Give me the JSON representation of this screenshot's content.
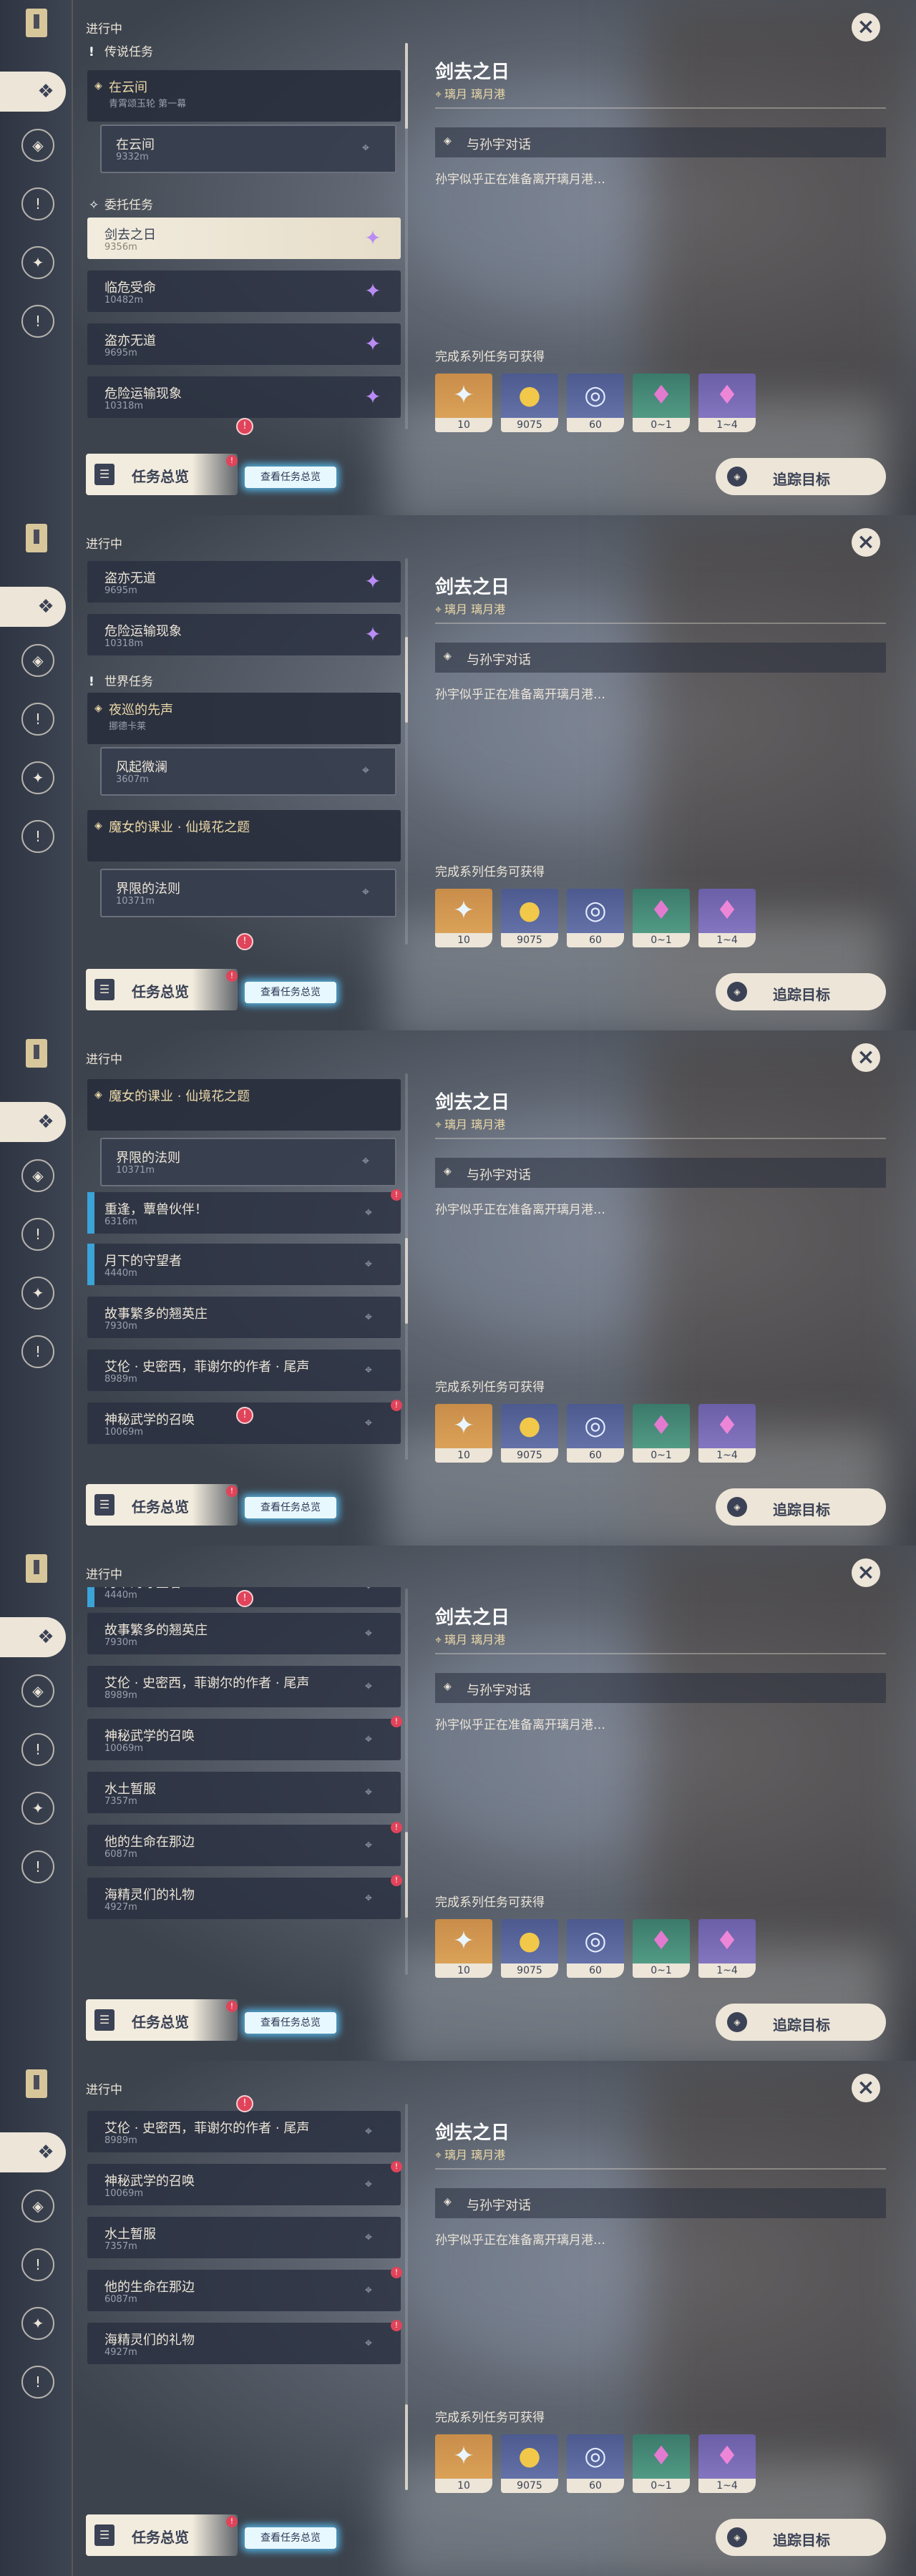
{
  "header": {
    "in_progress": "进行中"
  },
  "sections": {
    "legendary": "传说任务",
    "commission": "委托任务",
    "world": "世界任务"
  },
  "legend_chain": {
    "title": "在云间",
    "sub": "青霄颂玉轮 第一幕"
  },
  "legend_sub": {
    "name": "在云间",
    "dist": "9332m"
  },
  "commissions": [
    {
      "name": "剑去之日",
      "dist": "9356m"
    },
    {
      "name": "临危受命",
      "dist": "10482m"
    },
    {
      "name": "盗亦无道",
      "dist": "9695m"
    },
    {
      "name": "危险运输现象",
      "dist": "10318m"
    }
  ],
  "world_chain1": {
    "title": "夜巡的先声",
    "sub": "挪德卡莱"
  },
  "world_sub1": {
    "name": "风起微澜",
    "dist": "3607m"
  },
  "world_chain2": {
    "title": "魔女的课业 · 仙境花之题"
  },
  "world_sub2": {
    "name": "界限的法则",
    "dist": "10371m"
  },
  "world_items": [
    {
      "name": "重逢，蕈兽伙伴！",
      "dist": "6316m"
    },
    {
      "name": "月下的守望者",
      "dist": "4440m"
    },
    {
      "name": "故事繁多的翘英庄",
      "dist": "7930m"
    },
    {
      "name": "艾伦 · 史密西，菲谢尔的作者 · 尾声",
      "dist": "8989m"
    },
    {
      "name": "神秘武学的召唤",
      "dist": "10069m"
    },
    {
      "name": "水土暂服",
      "dist": "7357m"
    },
    {
      "name": "他的生命在那边",
      "dist": "6087m"
    },
    {
      "name": "海精灵们的礼物",
      "dist": "4927m"
    }
  ],
  "details": {
    "title": "剑去之日",
    "location": "璃月  璃月港",
    "objective": "与孙宇对话",
    "description": "孙宇似乎正在准备离开璃月港…",
    "rewards_title": "完成系列任务可获得",
    "rewards": [
      {
        "icon": "primogem-icon",
        "count": "10"
      },
      {
        "icon": "mora-icon",
        "count": "9075"
      },
      {
        "icon": "exp-icon",
        "count": "60"
      },
      {
        "icon": "ore-icon",
        "count": "0~1"
      },
      {
        "icon": "crystal-icon",
        "count": "1~4"
      }
    ]
  },
  "footer": {
    "overview": "任务总览",
    "view_all": "查看任务总览",
    "track": "追踪目标"
  },
  "colors": {
    "accent": "#ece5d8",
    "purple_star": "#b98cf5",
    "alert": "#e0445a",
    "blue_bar": "#3aa3d8"
  }
}
